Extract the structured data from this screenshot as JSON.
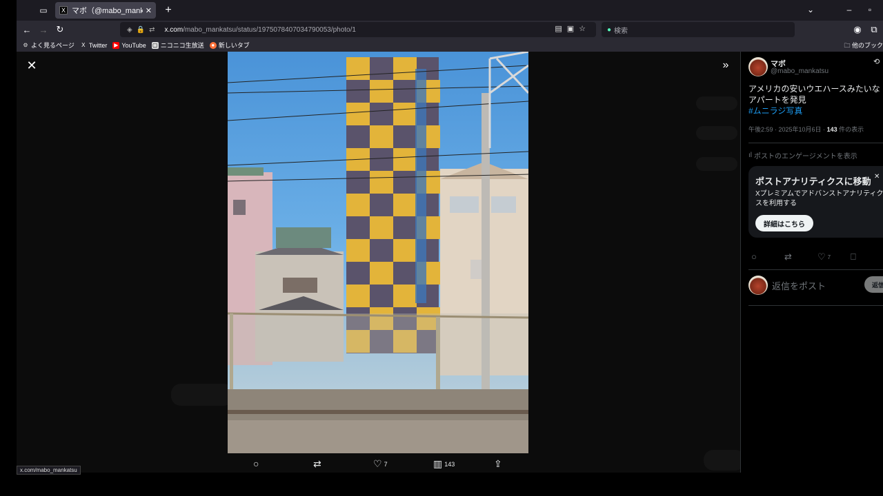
{
  "browser": {
    "tab_title": "マボ（@mabo_mankatsu）さん /",
    "tab_close": "✕",
    "new_tab": "+",
    "url_host": "x.com",
    "url_path": "/mabo_mankatsu/status/1975078407034790053/photo/1",
    "search_placeholder": "検索",
    "bookmarks": [
      {
        "label": "よく見るページ",
        "icon": "gear-icon"
      },
      {
        "label": "Twitter",
        "icon": "x-logo-icon"
      },
      {
        "label": "YouTube",
        "icon": "youtube-icon"
      },
      {
        "label": "ニコニコ生放送",
        "icon": "niconico-icon"
      },
      {
        "label": "新しいタブ",
        "icon": "firefox-icon"
      }
    ],
    "other_bookmarks": "他のブック",
    "status_url": "x.com/mabo_mankatsu"
  },
  "viewer": {
    "close_label": "✕",
    "expand_label": "»",
    "actions": {
      "reply_count": "",
      "repost_count": "",
      "like_count": "7",
      "views_count": "143"
    }
  },
  "post": {
    "author_name": "マボ",
    "author_handle": "@mabo_mankatsu",
    "text": "アメリカの安いウエハースみたいなアパートを発見",
    "hashtag": "#ムニラジ写真",
    "time": "午後2:59 · 2025年10月6日 · ",
    "views": "143",
    "views_suffix": " 件の表示",
    "engagement_link": "ポストのエンゲージメントを表示",
    "promo": {
      "title": "ポストアナリティクスに移動",
      "body": "Xプレミアムでアドバンストアナリティクスを利用する",
      "button": "詳細はこちら"
    },
    "like_count": "7",
    "reply_placeholder": "返信をポスト",
    "reply_button": "返信"
  }
}
